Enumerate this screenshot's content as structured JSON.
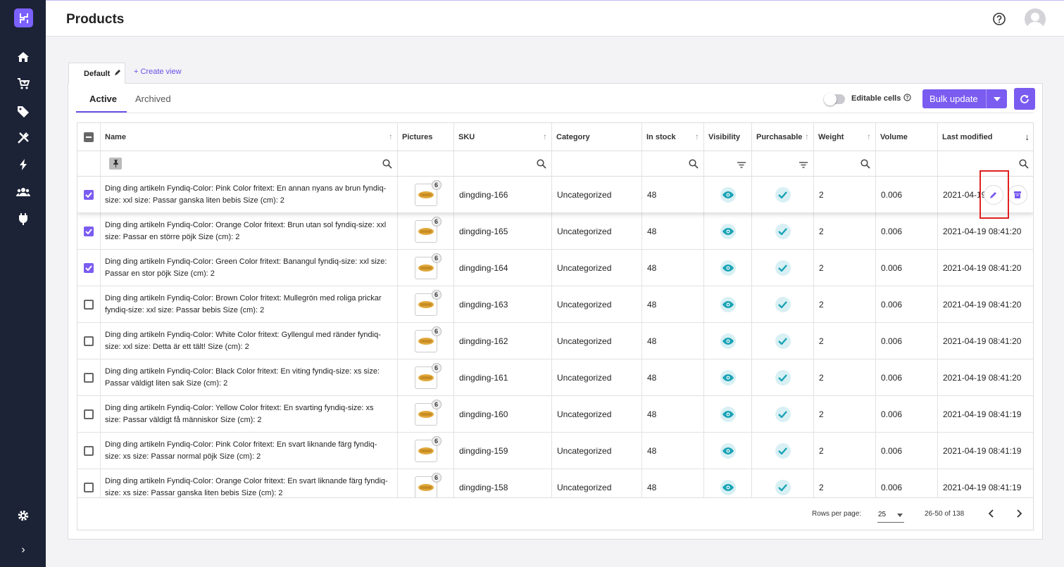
{
  "page": {
    "title": "Products"
  },
  "sidebar": {
    "items": [
      {
        "name": "home-icon"
      },
      {
        "name": "cart-icon"
      },
      {
        "name": "tag-icon"
      },
      {
        "name": "tools-icon"
      },
      {
        "name": "bolt-icon"
      },
      {
        "name": "users-icon"
      },
      {
        "name": "plug-icon"
      }
    ],
    "settings": "gear-icon",
    "expand": "›"
  },
  "views": {
    "default_label": "Default",
    "create_label": "+ Create view"
  },
  "tabs": {
    "active": "Active",
    "archived": "Archived"
  },
  "toolbar": {
    "editable_label": "Editable cells",
    "bulk_label": "Bulk update"
  },
  "colors": {
    "accent": "#7b5cf0",
    "sidebar": "#1c2337",
    "check": "#1aa3b5"
  },
  "table": {
    "columns": [
      "Name",
      "Pictures",
      "SKU",
      "Category",
      "In stock",
      "Visibility",
      "Purchasable",
      "Weight",
      "Volume",
      "Last modified"
    ],
    "rows": [
      {
        "checked": true,
        "name": "Ding ding artikeln Fyndiq-Color: Pink Color fritext: En annan nyans av brun fyndiq-size: xxl size: Passar ganska liten bebis Size (cm): 2",
        "pictures": "6",
        "sku": "dingding-166",
        "category": "Uncategorized",
        "stock": "48",
        "weight": "2",
        "volume": "0.006",
        "modified": "2021-04-19"
      },
      {
        "checked": true,
        "name": "Ding ding artikeln Fyndiq-Color: Orange Color fritext: Brun utan sol fyndiq-size: xxl size: Passar en större pöjk Size (cm): 2",
        "pictures": "6",
        "sku": "dingding-165",
        "category": "Uncategorized",
        "stock": "48",
        "weight": "2",
        "volume": "0.006",
        "modified": "2021-04-19 08:41:20"
      },
      {
        "checked": true,
        "name": "Ding ding artikeln Fyndiq-Color: Green Color fritext: Banangul fyndiq-size: xxl size: Passar en stor pöjk Size (cm): 2",
        "pictures": "6",
        "sku": "dingding-164",
        "category": "Uncategorized",
        "stock": "48",
        "weight": "2",
        "volume": "0.006",
        "modified": "2021-04-19 08:41:20"
      },
      {
        "checked": false,
        "name": "Ding ding artikeln Fyndiq-Color: Brown Color fritext: Mullegrön med roliga prickar fyndiq-size: xxl size: Passar bebis Size (cm): 2",
        "pictures": "6",
        "sku": "dingding-163",
        "category": "Uncategorized",
        "stock": "48",
        "weight": "2",
        "volume": "0.006",
        "modified": "2021-04-19 08:41:20"
      },
      {
        "checked": false,
        "name": "Ding ding artikeln Fyndiq-Color: White Color fritext: Gyllengul med ränder fyndiq-size: xxl size: Detta är ett tält! Size (cm): 2",
        "pictures": "6",
        "sku": "dingding-162",
        "category": "Uncategorized",
        "stock": "48",
        "weight": "2",
        "volume": "0.006",
        "modified": "2021-04-19 08:41:20"
      },
      {
        "checked": false,
        "name": "Ding ding artikeln Fyndiq-Color: Black Color fritext: En viting fyndiq-size: xs size: Passar väldigt liten sak Size (cm): 2",
        "pictures": "6",
        "sku": "dingding-161",
        "category": "Uncategorized",
        "stock": "48",
        "weight": "2",
        "volume": "0.006",
        "modified": "2021-04-19 08:41:20"
      },
      {
        "checked": false,
        "name": "Ding ding artikeln Fyndiq-Color: Yellow Color fritext: En svarting fyndiq-size: xs size: Passar väldigt få människor Size (cm): 2",
        "pictures": "6",
        "sku": "dingding-160",
        "category": "Uncategorized",
        "stock": "48",
        "weight": "2",
        "volume": "0.006",
        "modified": "2021-04-19 08:41:19"
      },
      {
        "checked": false,
        "name": "Ding ding artikeln Fyndiq-Color: Pink Color fritext: En svart liknande färg fyndiq-size: xs size: Passar normal pöjk Size (cm): 2",
        "pictures": "6",
        "sku": "dingding-159",
        "category": "Uncategorized",
        "stock": "48",
        "weight": "2",
        "volume": "0.006",
        "modified": "2021-04-19 08:41:19"
      },
      {
        "checked": false,
        "name": "Ding ding artikeln Fyndiq-Color: Orange Color fritext: En svart liknande färg fyndiq-size: xs size: Passar ganska liten bebis Size (cm): 2",
        "pictures": "6",
        "sku": "dingding-158",
        "category": "Uncategorized",
        "stock": "48",
        "weight": "2",
        "volume": "0.006",
        "modified": "2021-04-19 08:41:19"
      }
    ]
  },
  "footer": {
    "rows_per_page_label": "Rows per page:",
    "rows_per_page": "25",
    "range": "26-50 of 138"
  }
}
